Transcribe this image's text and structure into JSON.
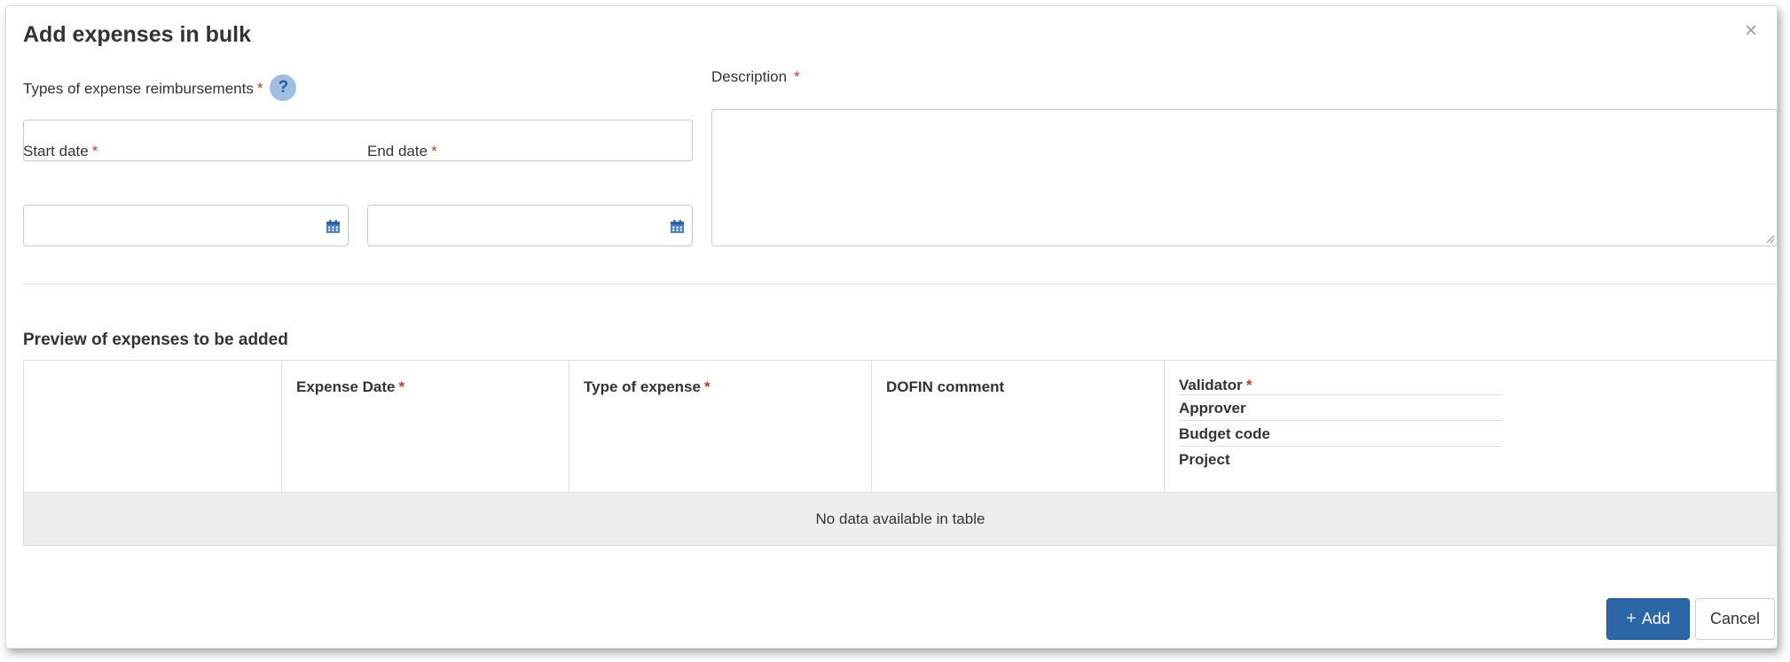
{
  "modal": {
    "title": "Add expenses in bulk",
    "close_symbol": "×"
  },
  "form": {
    "types_label": "Types of expense reimbursements",
    "required_mark": "*",
    "help_symbol": "?",
    "types_value": "",
    "start_date_label": "Start date",
    "start_date_value": "",
    "end_date_label": "End date",
    "end_date_value": "",
    "description_label": "Description",
    "description_value": ""
  },
  "preview": {
    "title": "Preview of expenses to be added",
    "columns": [
      "",
      "Expense Date",
      "Type of expense",
      "DOFIN comment",
      "Validator"
    ],
    "last_column_sublines": [
      "Approver",
      "Budget code",
      "Project"
    ],
    "empty_text": "No data available in table"
  },
  "buttons": {
    "add_icon": "+",
    "add_label": "Add",
    "cancel_label": "Cancel"
  },
  "colors": {
    "primary": "#2a66a8",
    "required": "#c0392b",
    "help_bg": "#9fbee2"
  },
  "icons": {
    "close": "close-icon",
    "help": "help-icon",
    "calendar": "calendar-icon",
    "add": "plus-icon"
  }
}
